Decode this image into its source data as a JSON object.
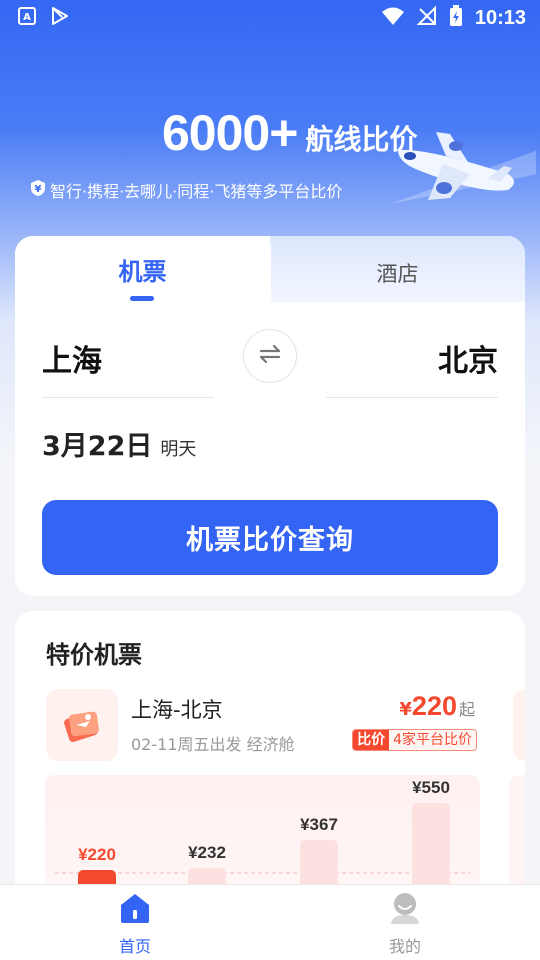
{
  "status_bar": {
    "time": "10:13"
  },
  "hero": {
    "headline_number": "6000+",
    "headline_text": "航线比价",
    "subline": "智行·携程·去哪儿·同程·飞猪等多平台比价"
  },
  "search_card": {
    "tabs": [
      {
        "label": "机票",
        "active": true
      },
      {
        "label": "酒店",
        "active": false
      }
    ],
    "from_city": "上海",
    "to_city": "北京",
    "date": "3月22日",
    "date_hint": "明天",
    "search_button": "机票比价查询"
  },
  "deals": {
    "title": "特价机票",
    "route": {
      "name": "上海-北京",
      "meta": "02-11周五出发 经济舱",
      "price_symbol": "¥",
      "price": "220",
      "price_suffix": "起",
      "tag_label": "比价",
      "tag_text": "4家平台比价"
    },
    "chart_data": {
      "type": "bar",
      "categories": [
        "",
        "",
        "",
        ""
      ],
      "values": [
        220,
        232,
        367,
        550
      ],
      "value_labels": [
        "¥220",
        "¥232",
        "¥367",
        "¥550"
      ],
      "highlight_index": 0,
      "colors": {
        "highlight": "#f4482f",
        "normal": "#fde0e0"
      }
    }
  },
  "bottom_nav": {
    "items": [
      {
        "label": "首页",
        "active": true
      },
      {
        "label": "我的",
        "active": false
      }
    ]
  },
  "colors": {
    "primary": "#3464f3",
    "price_red": "#f4482f"
  }
}
